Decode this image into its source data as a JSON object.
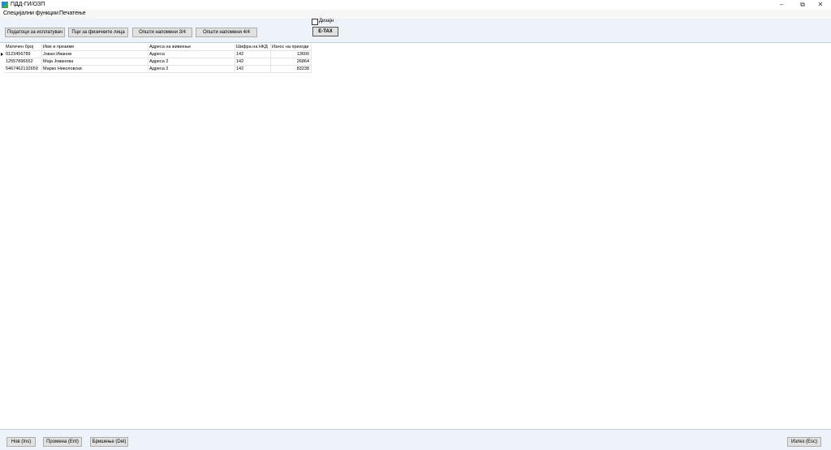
{
  "window": {
    "title": "ПДД-ГИ/ОЗП"
  },
  "menu": {
    "items": [
      "Специјални функции",
      "Печатење"
    ]
  },
  "toolbar": {
    "buttons": [
      "Податоци за исплатувач",
      "Пци за физичките лица",
      "Општи напомени 3/4",
      "Општи напомени 4/4"
    ],
    "checkbox_label": "Дизајн",
    "etax_label": "E-TAX"
  },
  "grid": {
    "columns": [
      "Матичен број",
      "Име и презиме",
      "Адреса на живеење",
      "Шифра на НКД",
      "Износ на приходи"
    ],
    "rows": [
      [
        "0123456789",
        "Јован Иванов",
        "Адреса",
        "142",
        "13600"
      ],
      [
        "12557896552",
        "Маја Јованова",
        "Адреса 2",
        "142",
        "26864"
      ],
      [
        "5467462132659",
        "Марко Николовски",
        "Адреса 2",
        "142",
        "83238"
      ]
    ]
  },
  "footer": {
    "new": "Нов (Ins)",
    "edit": "Промена (Ent)",
    "delete": "Бришење (Del)",
    "exit": "Излез (Esc)"
  }
}
